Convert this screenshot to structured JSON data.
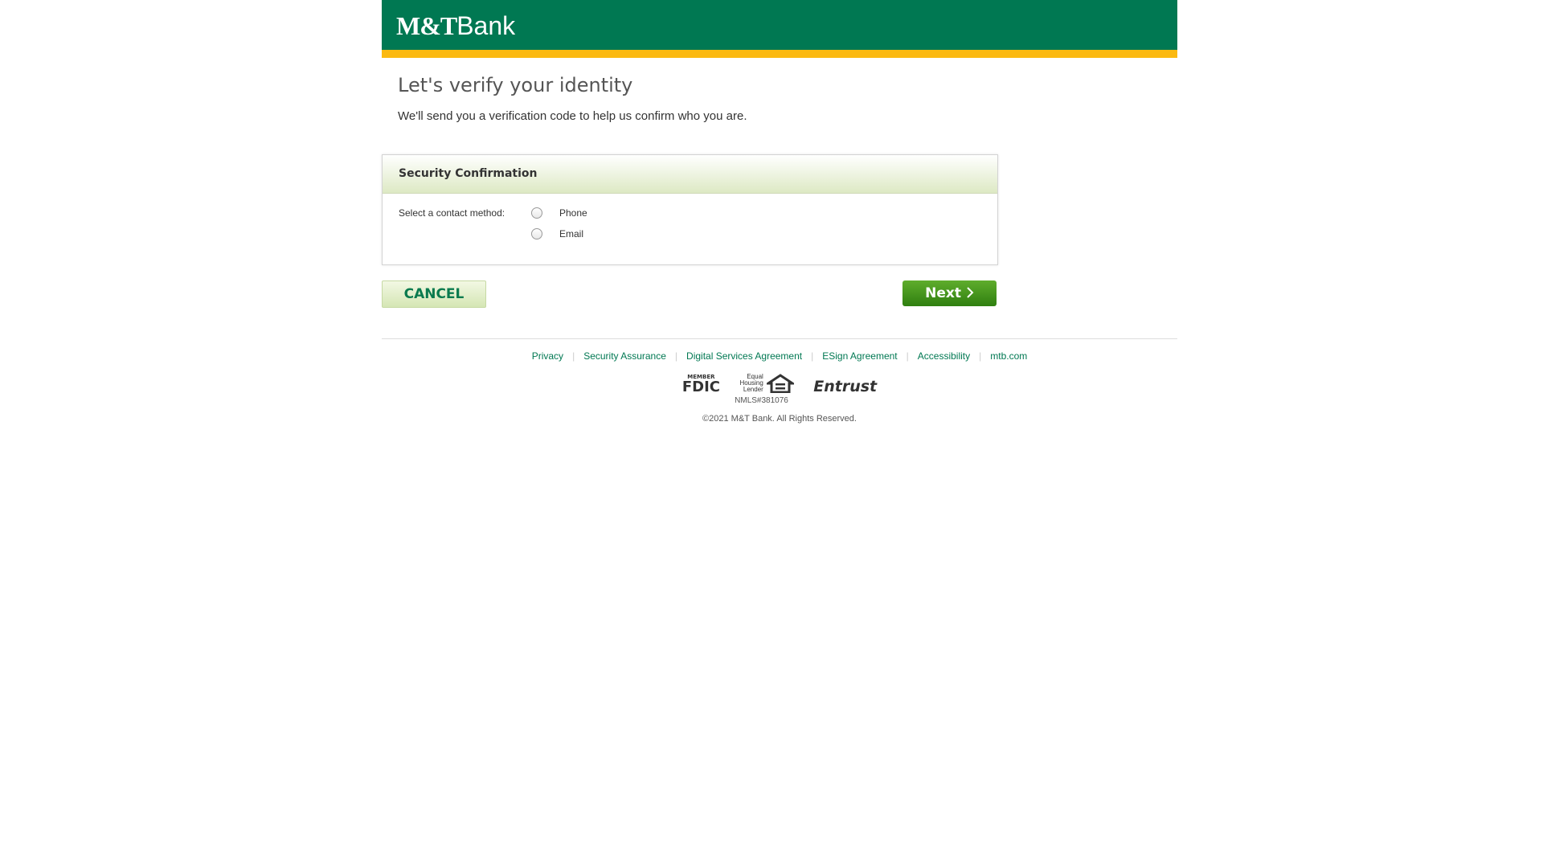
{
  "brand": {
    "logo_text": "M&T",
    "logo_bank": "Bank",
    "header_color": "#007852",
    "stripe_color": "#fbb911"
  },
  "page": {
    "title": "Let's verify your identity",
    "subtitle": "We'll send you a verification code to help us confirm who you are."
  },
  "card": {
    "title": "Security Confirmation",
    "field_label": "Select a contact method:",
    "options": [
      "Phone",
      "Email"
    ]
  },
  "buttons": {
    "cancel": "CANCEL",
    "next": "Next"
  },
  "icons": {
    "next_arrow": "chevron-right-icon"
  },
  "footer": {
    "links": [
      "Privacy",
      "Security Assurance",
      "Digital Services Agreement",
      "ESign Agreement",
      "Accessibility",
      "mtb.com"
    ],
    "badges": {
      "fdic_member": "MEMBER",
      "fdic": "FDIC",
      "ehl": [
        "Equal",
        "Housing",
        "Lender"
      ],
      "entrust": "Entrust"
    },
    "nmls": "NMLS#381076",
    "copyright": "©2021 M&T Bank. All Rights Reserved."
  }
}
